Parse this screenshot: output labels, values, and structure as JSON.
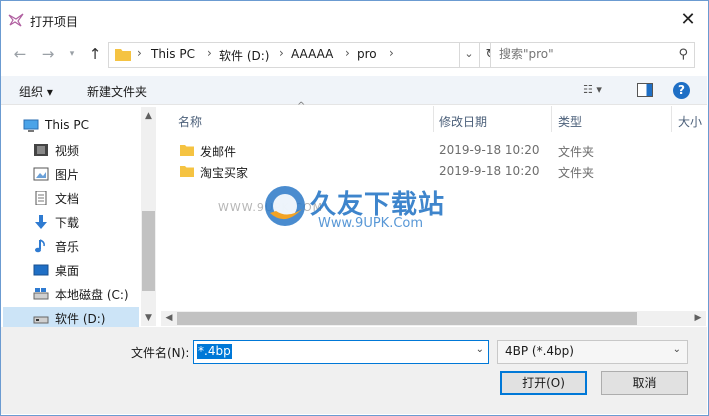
{
  "window": {
    "title": "打开项目"
  },
  "nav": {
    "breadcrumb": [
      "This PC",
      "软件 (D:)",
      "AAAAA",
      "pro"
    ],
    "search_placeholder": "搜索\"pro\""
  },
  "toolbar": {
    "organize_label": "组织 ▾",
    "new_folder_label": "新建文件夹"
  },
  "sidebar": {
    "items": [
      {
        "label": "This PC",
        "icon": "computer-icon"
      },
      {
        "label": "视频",
        "icon": "video-icon"
      },
      {
        "label": "图片",
        "icon": "picture-icon"
      },
      {
        "label": "文档",
        "icon": "document-icon"
      },
      {
        "label": "下载",
        "icon": "download-icon"
      },
      {
        "label": "音乐",
        "icon": "music-icon"
      },
      {
        "label": "桌面",
        "icon": "desktop-icon"
      },
      {
        "label": "本地磁盘 (C:)",
        "icon": "drive-icon"
      },
      {
        "label": "软件 (D:)",
        "icon": "drive-icon",
        "selected": true
      }
    ]
  },
  "columns": {
    "name": "名称",
    "date": "修改日期",
    "type": "类型",
    "size": "大小"
  },
  "files": [
    {
      "name": "发邮件",
      "date": "2019-9-18 10:20",
      "type": "文件夹"
    },
    {
      "name": "淘宝买家",
      "date": "2019-9-18 10:20",
      "type": "文件夹"
    }
  ],
  "footer": {
    "filename_label": "文件名(N):",
    "filename_value": "*.4bp",
    "filetype_value": "4BP (*.4bp)",
    "open_label": "打开(O)",
    "cancel_label": "取消"
  },
  "watermark": {
    "text": "久友下载站",
    "url": "Www.9UPK.Com",
    "small": "WWW.9UPK.COM"
  },
  "colors": {
    "accent": "#0078d7",
    "help": "#1f6fc5",
    "folder": "#f5c342"
  }
}
